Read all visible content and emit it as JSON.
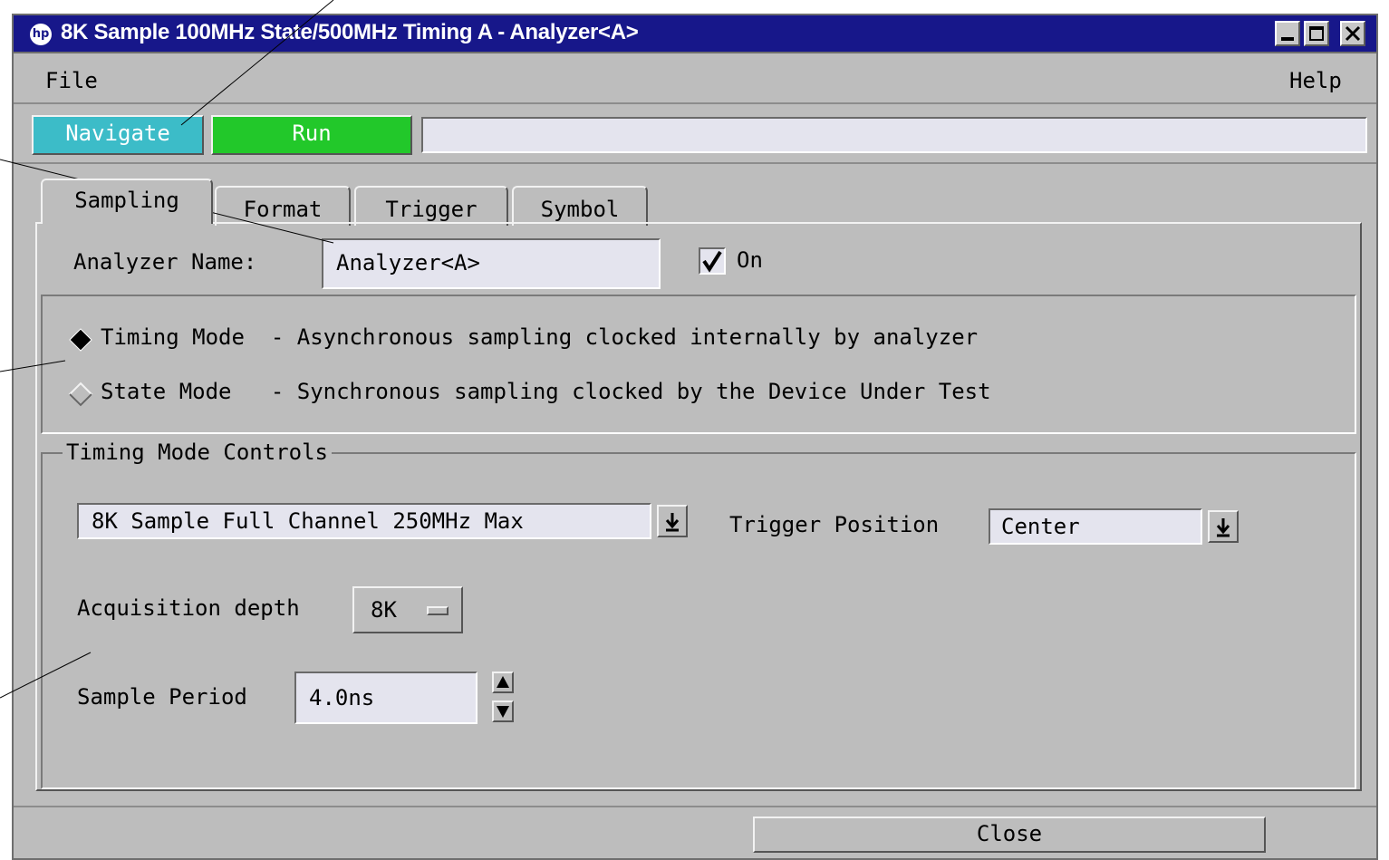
{
  "window": {
    "title": "8K Sample 100MHz State/500MHz Timing A - Analyzer<A>",
    "logo": "hp",
    "controls": [
      "minimize-icon",
      "maximize-icon",
      "close-icon"
    ]
  },
  "menubar": {
    "file": "File",
    "help": "Help"
  },
  "toolbar": {
    "navigate_label": "Navigate",
    "run_label": "Run",
    "status_value": "",
    "navigate_color": "#3cbcc8",
    "run_color": "#22c82a"
  },
  "tabs": [
    "Sampling",
    "Format",
    "Trigger",
    "Symbol"
  ],
  "active_tab": "Sampling",
  "analyzer": {
    "name_label": "Analyzer Name:",
    "name_value": "Analyzer<A>",
    "on_label": "On",
    "on_checked": true
  },
  "modes": {
    "timing": "Timing Mode  - Asynchronous sampling clocked internally by analyzer",
    "state": "State Mode   - Synchronous sampling clocked by the Device Under Test",
    "selected": "timing"
  },
  "timing_controls": {
    "group_label": "Timing Mode Controls",
    "sample_mode_value": "8K Sample Full Channel 250MHz Max",
    "trigger_position_label": "Trigger Position",
    "trigger_position_value": "Center",
    "acquisition_depth_label": "Acquisition depth",
    "acquisition_depth_value": "8K",
    "sample_period_label": "Sample Period",
    "sample_period_value": "4.0ns"
  },
  "footer": {
    "close_label": "Close"
  }
}
